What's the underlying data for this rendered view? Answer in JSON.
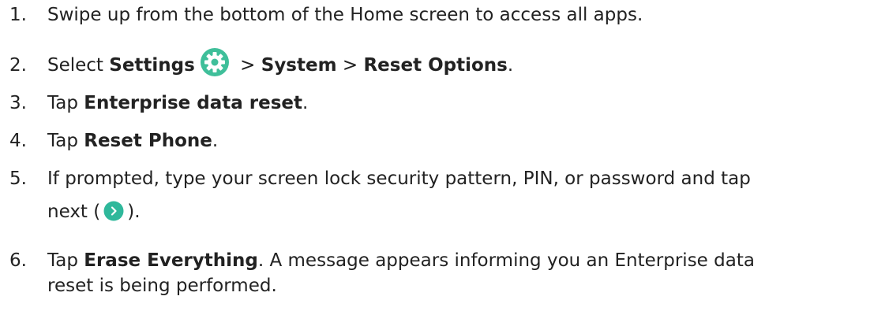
{
  "colors": {
    "text": "#222222",
    "settings_icon_bg": "#3fbf9a",
    "next_icon_bg": "#2fb89b"
  },
  "steps": [
    {
      "number": "1.",
      "text": "Swipe up from the bottom of the Home screen to access all apps."
    },
    {
      "number": "2.",
      "prefix": "Select ",
      "settings": "Settings",
      "sep1": " > ",
      "system": "System",
      "sep2": " > ",
      "reset_options": "Reset Options",
      "suffix": ".",
      "settings_icon": "settings-gear-icon"
    },
    {
      "number": "3.",
      "prefix": "Tap ",
      "bold": "Enterprise data reset",
      "suffix": "."
    },
    {
      "number": "4.",
      "prefix": "Tap ",
      "bold": "Reset Phone",
      "suffix": "."
    },
    {
      "number": "5.",
      "line1": "If prompted, type your screen lock security pattern, PIN, or password and tap",
      "line2_prefix": "next (",
      "line2_suffix": ").",
      "next_icon": "next-arrow-icon"
    },
    {
      "number": "6.",
      "prefix": "Tap ",
      "bold": "Erase Everything",
      "line1_rest": ". A message appears informing you an Enterprise data",
      "line2": "reset is being performed."
    }
  ]
}
